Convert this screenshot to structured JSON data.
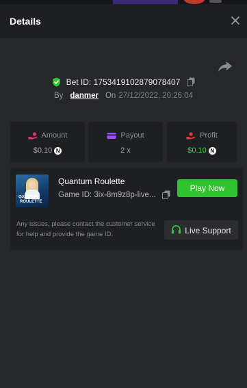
{
  "header": {
    "title": "Details"
  },
  "bet": {
    "id_label": "Bet ID: 1753419102879078407",
    "by_label": "By",
    "user": "danmer",
    "on_label": "On",
    "date": "27/12/2022, 20:26:04"
  },
  "stats": {
    "amount": {
      "label": "Amount",
      "value": "$0.10",
      "currency_badge": "N"
    },
    "payout": {
      "label": "Payout",
      "value": "2 x"
    },
    "profit": {
      "label": "Profit",
      "value": "$0.10",
      "currency_badge": "N"
    }
  },
  "game": {
    "name": "Quantum Roulette",
    "id_label": "Game ID: 3ix-8m9z8p-live...",
    "thumbnail_text_1": "QUANTUM",
    "thumbnail_text_2": "ROULETTE",
    "play_label": "Play Now",
    "issues_text": "Any issues, please contact the customer service for help and provide the game ID.",
    "support_label": "Live Support"
  },
  "colors": {
    "accent_green": "#31c22f",
    "profit_green": "#3cd23c",
    "amount_icon": "#e0356b",
    "payout_icon": "#9b4dff",
    "profit_icon": "#e23c3c"
  }
}
